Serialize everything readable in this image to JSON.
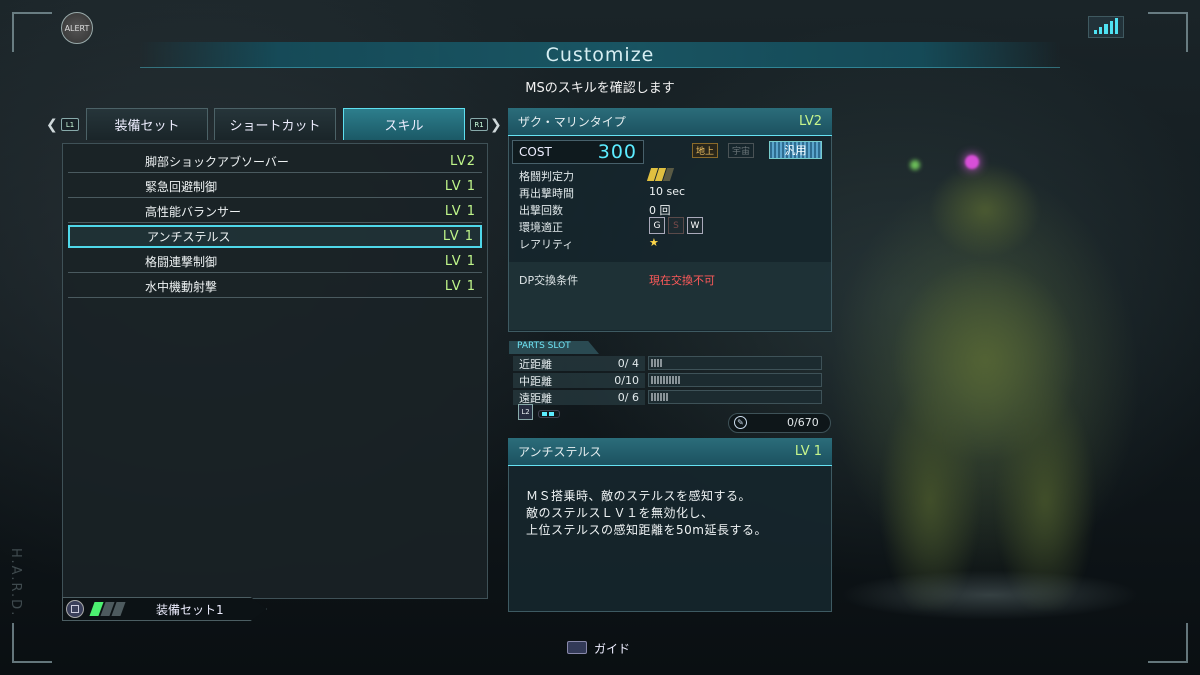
{
  "header": {
    "alert": "ALERT",
    "title": "Customize",
    "subtitle": "MSのスキルを確認します",
    "side_text": "H.A.R.D."
  },
  "tabs": {
    "left_key": "L1",
    "right_key": "R1",
    "items": [
      {
        "label": "装備セット",
        "active": false
      },
      {
        "label": "ショートカット",
        "active": false
      },
      {
        "label": "スキル",
        "active": true
      }
    ]
  },
  "skills": [
    {
      "name": "脚部ショックアブソーバー",
      "level": "LV2",
      "selected": false
    },
    {
      "name": "緊急回避制御",
      "level": "LV 1",
      "selected": false
    },
    {
      "name": "高性能バランサー",
      "level": "LV 1",
      "selected": false
    },
    {
      "name": "アンチステルス",
      "level": "LV 1",
      "selected": true
    },
    {
      "name": "格闘連撃制御",
      "level": "LV 1",
      "selected": false
    },
    {
      "name": "水中機動射撃",
      "level": "LV 1",
      "selected": false
    }
  ],
  "equip_set": {
    "label": "装備セット1",
    "active_pips": 1,
    "total_pips": 3
  },
  "ms": {
    "name": "ザク・マリンタイプ",
    "level": "LV2",
    "cost_label": "COST",
    "cost_value": "300",
    "env_ground": "地上",
    "env_space": "宇宙",
    "type": "汎用",
    "stats": {
      "melee_label": "格闘判定力",
      "melee_grade_text": "A1 A2 A3",
      "respawn_label": "再出撃時間",
      "respawn_value": "10 sec",
      "sortie_label": "出撃回数",
      "sortie_value": "0 回",
      "terrain_label": "環境適正",
      "terrain": [
        "G",
        "S",
        "W"
      ],
      "rarity_label": "レアリティ",
      "rarity_value": "★"
    },
    "dp_label": "DP交換条件",
    "dp_value": "現在交換不可"
  },
  "parts_slot": {
    "title": "PARTS SLOT",
    "rows": [
      {
        "label": "近距離",
        "value": "0/ 4",
        "slots": 4
      },
      {
        "label": "中距離",
        "value": "0/10",
        "slots": 10
      },
      {
        "label": "遠距離",
        "value": "0/ 6",
        "slots": 6
      }
    ],
    "l2_key": "L2",
    "capacity": "0/670"
  },
  "skill_detail": {
    "name": "アンチステルス",
    "level": "LV 1",
    "lines": [
      "ＭＳ搭乗時、敵のステルスを感知する。",
      "敵のステルスＬＶ１を無効化し、",
      "上位ステルスの感知距離を50m延長する。"
    ]
  },
  "footer": {
    "guide_label": "ガイド"
  },
  "colors": {
    "accent": "#4fd8ea",
    "level_green": "#bff58a",
    "cost_cyan": "#5cecff",
    "warning_red": "#ff5a5a"
  }
}
